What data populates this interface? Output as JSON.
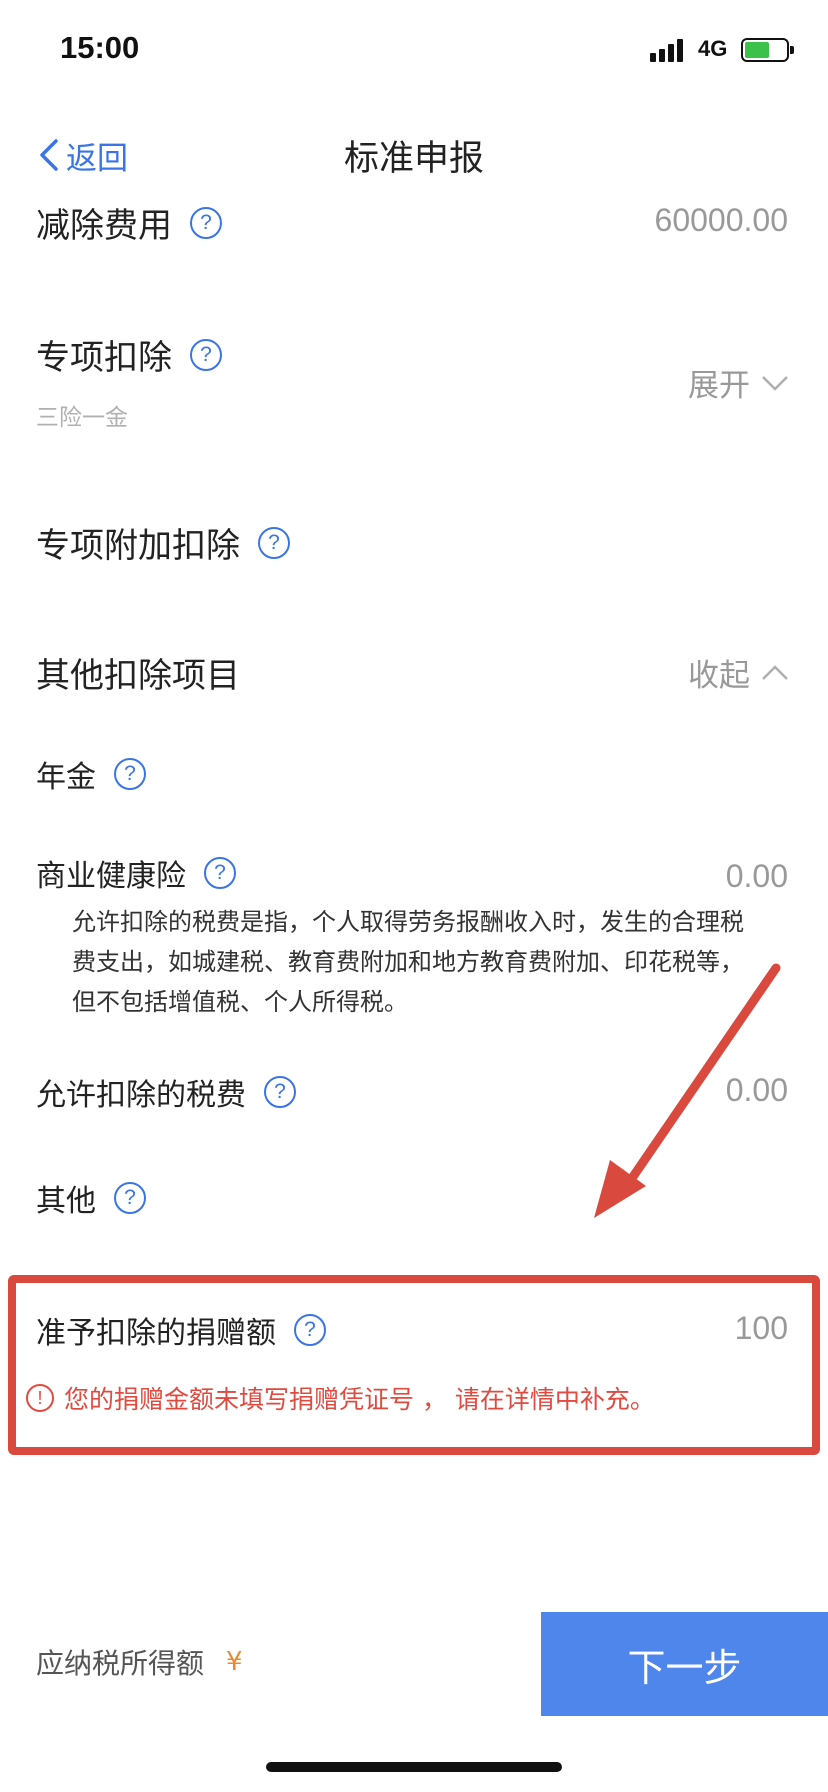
{
  "status_bar": {
    "time": "15:00",
    "network": "4G"
  },
  "nav": {
    "back_label": "返回",
    "title": "标准申报"
  },
  "rows": {
    "deduction_fee": {
      "label": "减除费用",
      "value": "60000.00"
    },
    "special": {
      "label": "专项扣除",
      "sublabel": "三险一金",
      "toggle": "展开"
    },
    "special_additional": {
      "label": "专项附加扣除"
    },
    "other_items": {
      "label": "其他扣除项目",
      "toggle": "收起"
    },
    "annuity": {
      "label": "年金"
    },
    "health_insurance": {
      "label": "商业健康险",
      "value": "0.00"
    },
    "allowed_tax": {
      "label": "允许扣除的税费",
      "value": "0.00"
    },
    "other": {
      "label": "其他"
    },
    "donation": {
      "label": "准予扣除的捐赠额",
      "value": "100"
    }
  },
  "help_icon_glyph": "?",
  "tooltip": {
    "text": "允许扣除的税费是指，个人取得劳务报酬收入时，发生的合理税费支出，如城建税、教育费附加和地方教育费附加、印花税等，但不包括增值税、个人所得税。"
  },
  "warning": {
    "icon_glyph": "!",
    "text": "您的捐赠金额未填写捐赠凭证号 ， 请在详情中补充。"
  },
  "footer": {
    "label": "应纳税所得额",
    "currency": "¥",
    "next_button": "下一步"
  },
  "colors": {
    "accent": "#3a74e6",
    "button": "#4f86ec",
    "warning": "#e04a3f",
    "annotation": "#d9493e",
    "currency": "#e8892f"
  }
}
